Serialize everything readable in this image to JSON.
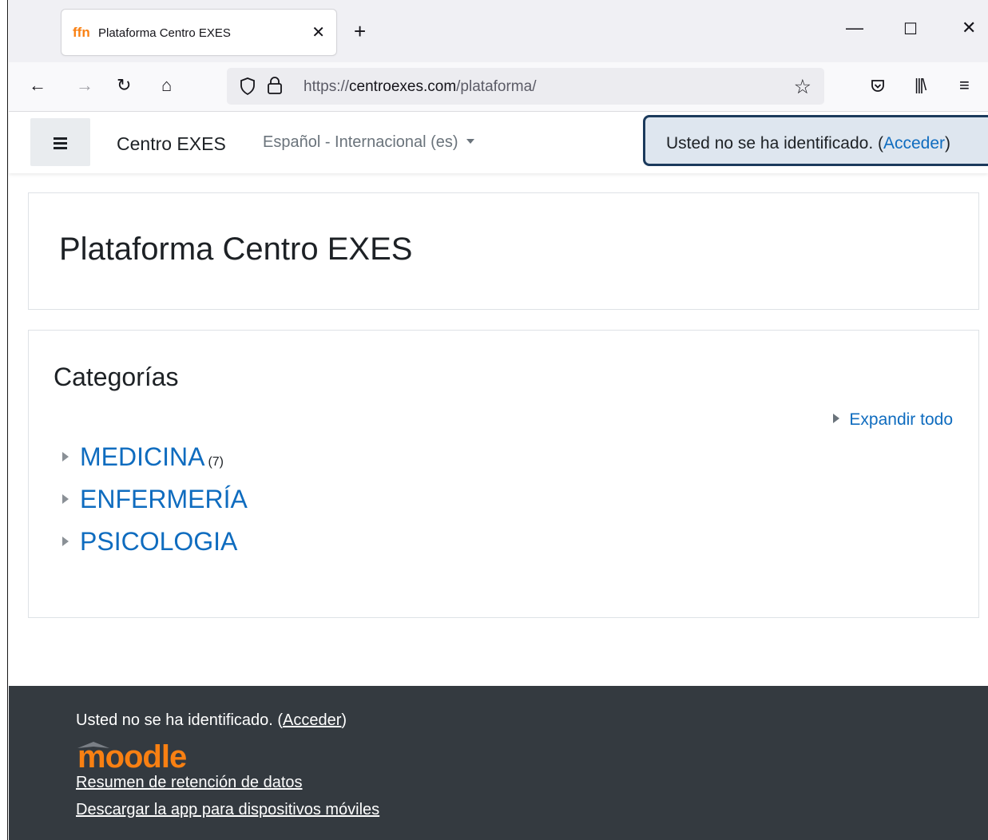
{
  "browser": {
    "tab_title": "Plataforma Centro EXES",
    "tab_favicon": "moodle-m-icon",
    "url_prefix": "https://",
    "url_domain": "centroexes.com",
    "url_path": "/plataforma/"
  },
  "header": {
    "brand": "Centro EXES",
    "language": "Español - Internacional (es)",
    "login_text": "Usted no se ha identificado.",
    "login_link": "Acceder"
  },
  "main": {
    "page_title": "Plataforma Centro EXES",
    "categories_heading": "Categorías",
    "expand_all": "Expandir todo",
    "categories": [
      {
        "name": "MEDICINA",
        "count": "(7)"
      },
      {
        "name": "ENFERMERÍA",
        "count": ""
      },
      {
        "name": "PSICOLOGIA",
        "count": ""
      }
    ]
  },
  "footer": {
    "login_text": "Usted no se ha identificado.",
    "login_link": "Acceder",
    "logo_text": "moodle",
    "link_data_retention": "Resumen de retención de datos",
    "link_mobile_app": "Descargar la app para dispositivos móviles"
  },
  "colors": {
    "link": "#0f6cbf",
    "footer_bg": "#343a40",
    "moodle_orange": "#f98012",
    "login_box_border": "#1b3a5c"
  }
}
